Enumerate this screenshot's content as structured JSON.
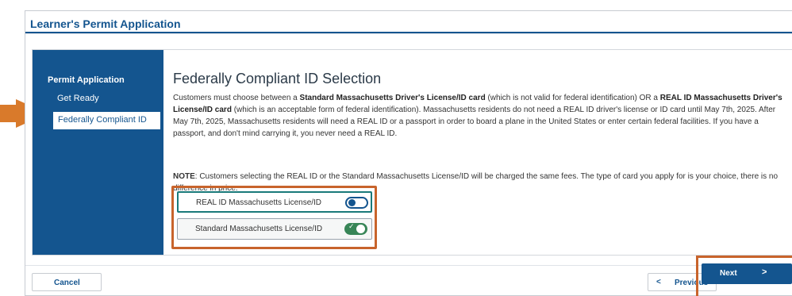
{
  "app": {
    "title": "Learner's Permit Application"
  },
  "sidebar": {
    "heading": "Permit Application",
    "items": [
      {
        "label": "Get Ready",
        "active": false
      },
      {
        "label": "Federally Compliant ID",
        "active": true
      }
    ]
  },
  "main": {
    "title": "Federally Compliant ID Selection",
    "para_1": "Customers must choose between a ",
    "para_bold_1": "Standard Massachusetts Driver's License/ID card",
    "para_2": " (which is not valid for federal identification) OR a ",
    "para_bold_2": "REAL ID Massachusetts Driver's License/ID card",
    "para_3": " (which is an acceptable form of federal identification). Massachusetts residents do not need a REAL ID driver's license or ID card until May 7th, 2025. After May 7th, 2025, Massachusetts residents will need a REAL ID or a passport in order to board a plane in the United States or enter certain federal facilities. If you have a passport, and don't mind carrying it, you never need a REAL ID.",
    "note_label": "NOTE",
    "note_text": ": Customers selecting the REAL ID or the Standard Massachusetts License/ID will be charged the same fees. The type of card you apply for is your choice, there is no difference in price.",
    "options": [
      {
        "label": "REAL ID Massachusetts License/ID",
        "checked": false
      },
      {
        "label": "Standard Massachusetts License/ID",
        "checked": true
      }
    ]
  },
  "footer": {
    "cancel_label": "Cancel",
    "previous_label": "Previous",
    "next_label": "Next"
  },
  "colors": {
    "brand": "#14558f",
    "callout": "#c8642c",
    "toggle_on": "#388557"
  },
  "icons": {
    "check": "check-icon",
    "prev": "chevron-left-icon",
    "next": "chevron-right-icon",
    "pointer": "arrow-pointer-icon"
  }
}
